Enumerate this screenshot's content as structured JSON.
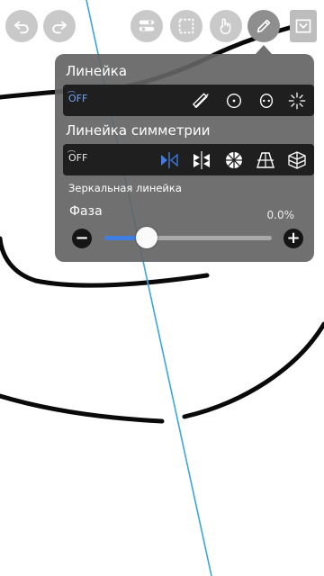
{
  "toolbar": {
    "undo_icon": "undo-icon",
    "redo_icon": "redo-icon",
    "layers_icon": "toggle-icon",
    "selection_icon": "selection-icon",
    "hand_icon": "hand-icon",
    "pen_icon": "pen-icon",
    "fill_icon": "fill-icon"
  },
  "ruler_section": {
    "title": "Линейка",
    "off_label": "OFF",
    "options": [
      "line-ruler-icon",
      "circle-ruler-icon",
      "ellipse-ruler-icon",
      "radial-ruler-icon"
    ]
  },
  "symmetry_section": {
    "title": "Линейка симметрии",
    "off_label": "OFF",
    "options": [
      "mirror-symmetry-icon",
      "kaleidoscope-symmetry-icon",
      "radial-symmetry-icon",
      "perspective-1pt-icon",
      "perspective-3pt-icon"
    ],
    "selected": "mirror-symmetry-icon"
  },
  "mirror_ruler": {
    "label": "Зеркальная линейка",
    "phase_label": "Фаза",
    "phase_value": "0.0%",
    "phase_fraction": 0.25,
    "minus": "−",
    "plus": "+"
  },
  "colors": {
    "accent": "#3f7de0",
    "panel": "#646464",
    "guide_line": "#3aa6e0"
  }
}
